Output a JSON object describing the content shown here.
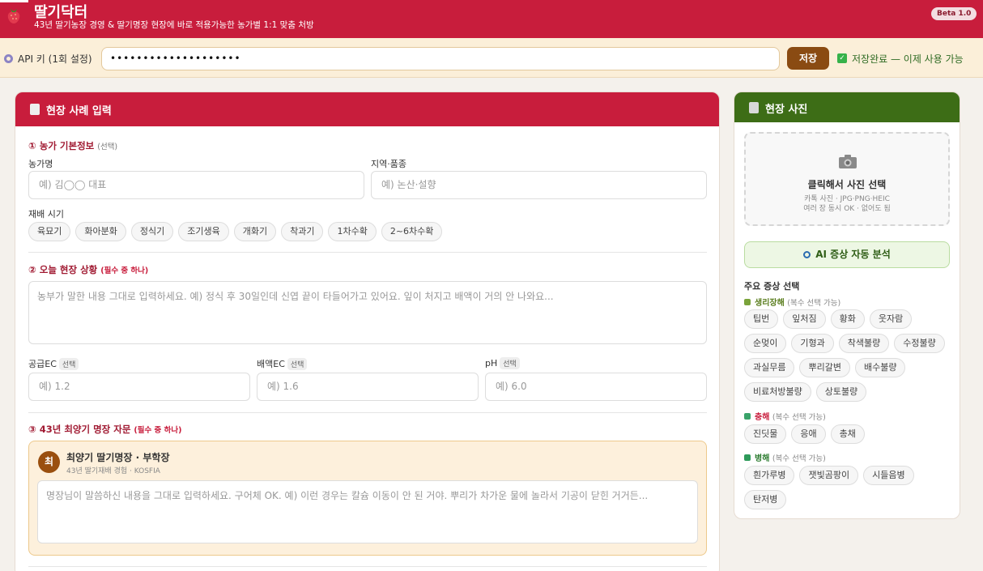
{
  "app": {
    "title": "딸기닥터",
    "subtitle": "43년 딸기농장 경영 & 딸기명장 현장에 바로 적용가능한 농가별 1:1 맞춤 처방",
    "version_badge": "Beta 1.0",
    "brand_color": "#c81d3c"
  },
  "api": {
    "label": "API 키 (1회 설정)",
    "key_value": "••••••••••••••••••••",
    "save_label": "저장",
    "status_text": "저장완료 — 이제 사용 가능"
  },
  "case": {
    "header": "현장 사례 입력",
    "section1": {
      "title": "① 농가 기본정보",
      "optional": "(선택)"
    },
    "farm_name": {
      "label": "농가명",
      "placeholder": "예) 김◯◯ 대표"
    },
    "region": {
      "label": "지역·품종",
      "placeholder": "예) 논산·설향"
    },
    "stage": {
      "label": "재배 시기",
      "options": [
        "육묘기",
        "화아분화",
        "정식기",
        "조기생육",
        "개화기",
        "착과기",
        "1차수확",
        "2~6차수확"
      ]
    },
    "section2": {
      "title": "② 오늘 현장 상황",
      "required": "(필수 중 하나)"
    },
    "situation_placeholder": "농부가 말한 내용 그대로 입력하세요. 예) 정식 후 30일인데 신엽 끝이 타들어가고 있어요. 잎이 처지고 배액이 거의 안 나와요...",
    "metrics": [
      {
        "label": "공급EC",
        "badge": "선택",
        "placeholder": "예) 1.2"
      },
      {
        "label": "배액EC",
        "badge": "선택",
        "placeholder": "예) 1.6"
      },
      {
        "label": "pH",
        "badge": "선택",
        "placeholder": "예) 6.0"
      }
    ],
    "section3": {
      "title": "③ 43년 최양기 명장 자문",
      "required": "(필수 중 하나)"
    },
    "mentor": {
      "initial": "최",
      "name": "최양기 딸기명장 · 부학장",
      "desc": "43년 딸기재배 경험 · KOSFIA",
      "placeholder": "명장님이 말씀하신 내용을 그대로 입력하세요. 구어체 OK. 예) 이런 경우는 칼슘 이동이 안 된 거야. 뿌리가 차가운 물에 놀라서 기공이 닫힌 거거든..."
    }
  },
  "photo": {
    "header": "현장 사진",
    "upload_title": "클릭해서 사진 선택",
    "upload_formats": "카톡 사진 · JPG·PNG·HEIC",
    "upload_note": "여러 장 동시 OK · 없어도 됨",
    "ai_button": "AI 증상 자동 분석",
    "symptoms_title": "주요 증상 선택",
    "groups": [
      {
        "name": "생리장해",
        "note": "(복수 선택 가능)",
        "color": "#5a7d1e",
        "items": [
          "팁번",
          "잎처짐",
          "황화",
          "웃자람",
          "순멎이",
          "기형과",
          "착색불량",
          "수정불량",
          "과실무름",
          "뿌리갈변",
          "배수불량",
          "비료처방불량",
          "상토불량"
        ]
      },
      {
        "name": "충해",
        "note": "(복수 선택 가능)",
        "color": "#c81d3c",
        "items": [
          "진딧물",
          "응애",
          "총채"
        ]
      },
      {
        "name": "병해",
        "note": "(복수 선택 가능)",
        "color": "#2e7d32",
        "items": [
          "흰가루병",
          "잿빛곰팡이",
          "시들음병",
          "탄저병"
        ]
      }
    ]
  }
}
